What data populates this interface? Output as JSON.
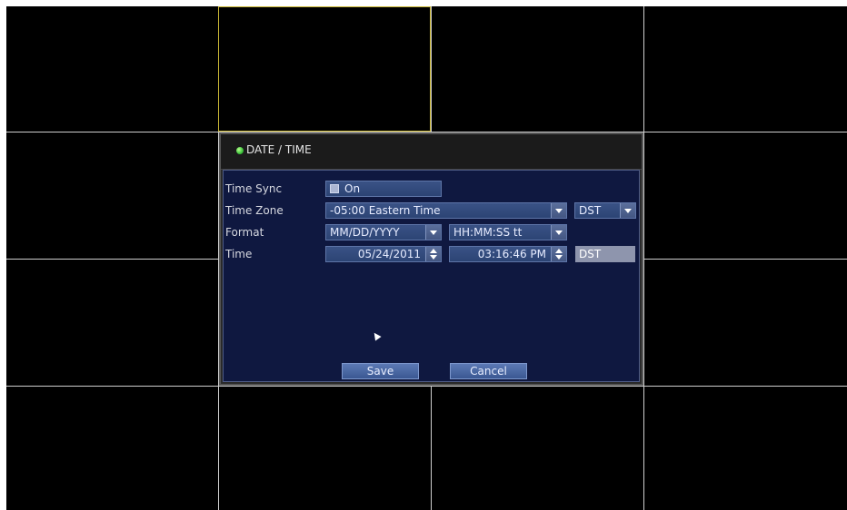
{
  "dialog": {
    "title": "DATE / TIME"
  },
  "form": {
    "time_sync": {
      "label": "Time Sync",
      "value": "On"
    },
    "time_zone": {
      "label": "Time Zone",
      "value": "-05:00 Eastern Time",
      "dst_option": "DST"
    },
    "format": {
      "label": "Format",
      "date_format": "MM/DD/YYYY",
      "time_format": "HH:MM:SS tt"
    },
    "time": {
      "label": "Time",
      "date": "05/24/2011",
      "time": "03:16:46 PM",
      "dst_indicator": "DST"
    }
  },
  "buttons": {
    "save": "Save",
    "cancel": "Cancel"
  },
  "colors": {
    "selected_cell_border": "#c9b635",
    "dialog_panel": "#0f1840",
    "status_dot": "#3cc23c"
  }
}
